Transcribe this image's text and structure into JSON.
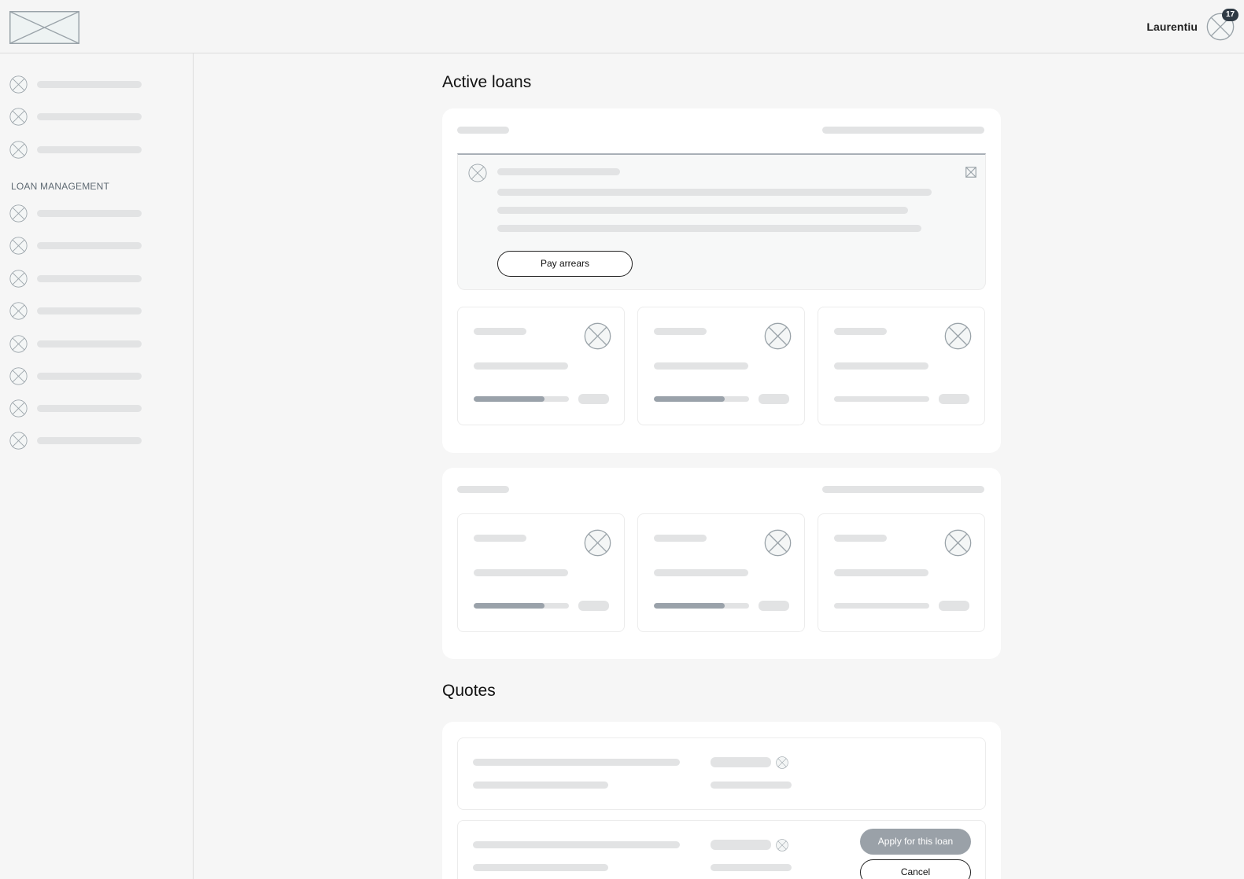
{
  "header": {
    "user_name": "Laurentiu",
    "notification_count": "17"
  },
  "sidebar": {
    "section_label": "LOAN MANAGEMENT"
  },
  "main": {
    "active_loans_title": "Active loans",
    "quotes_title": "Quotes",
    "pay_arrears_label": "Pay arrears",
    "apply_label": "Apply for this loan",
    "cancel_label": "Cancel"
  },
  "loan_progress": {
    "card1": [
      0.74,
      0.74,
      0.0
    ],
    "card2": [
      0.74,
      0.74,
      0.0
    ]
  },
  "colors": {
    "background": "#f6f6f6",
    "skeleton": "#e2e3e4",
    "progress_fill": "#9aa2aa",
    "badge": "#2f3a44",
    "primary_button": "#9aa1a8"
  }
}
